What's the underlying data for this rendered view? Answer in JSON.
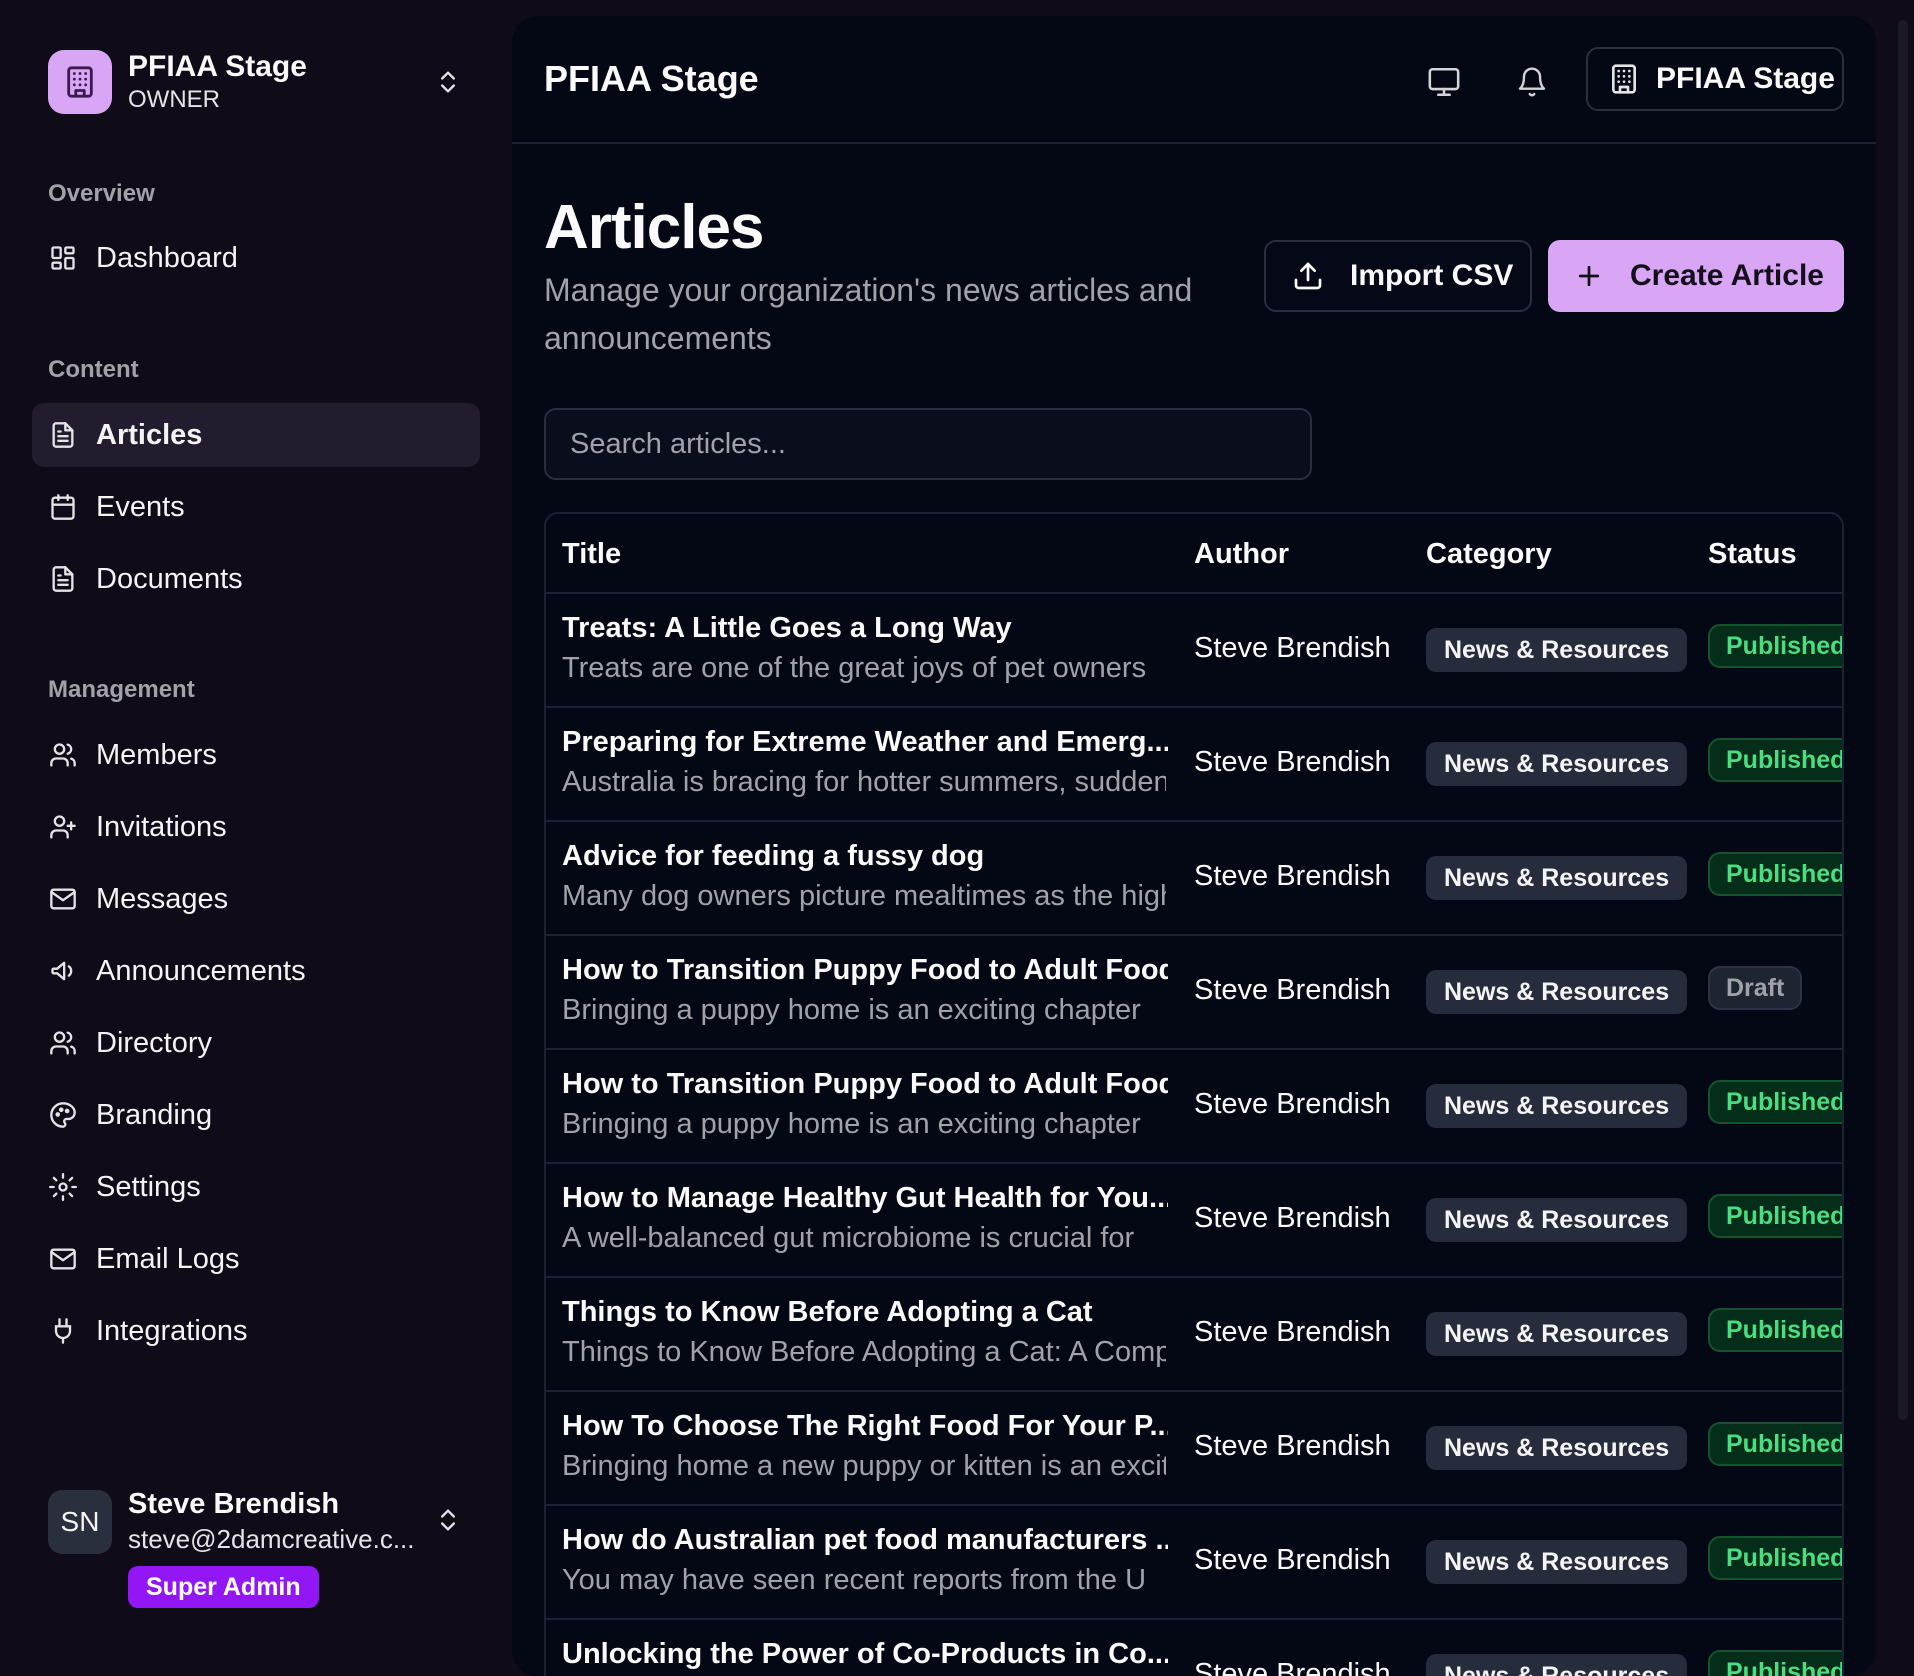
{
  "sidebar": {
    "org": {
      "name": "PFIAA Stage",
      "role": "OWNER"
    },
    "sections": [
      {
        "label": "Overview"
      },
      {
        "label": "Content"
      },
      {
        "label": "Management"
      }
    ],
    "items": [
      {
        "label": "Dashboard",
        "icon": "dashboard-icon"
      },
      {
        "label": "Articles",
        "icon": "document-icon",
        "active": true
      },
      {
        "label": "Events",
        "icon": "calendar-icon"
      },
      {
        "label": "Documents",
        "icon": "document-icon"
      },
      {
        "label": "Members",
        "icon": "users-icon"
      },
      {
        "label": "Invitations",
        "icon": "user-plus-icon"
      },
      {
        "label": "Messages",
        "icon": "mail-icon"
      },
      {
        "label": "Announcements",
        "icon": "megaphone-icon"
      },
      {
        "label": "Directory",
        "icon": "users-icon"
      },
      {
        "label": "Branding",
        "icon": "palette-icon"
      },
      {
        "label": "Settings",
        "icon": "gear-icon"
      },
      {
        "label": "Email Logs",
        "icon": "mail-icon"
      },
      {
        "label": "Integrations",
        "icon": "plug-icon"
      }
    ],
    "user": {
      "initials": "SN",
      "name": "Steve Brendish",
      "email": "steve@2damcreative.c...",
      "badge": "Super Admin"
    }
  },
  "topbar": {
    "title": "PFIAA Stage",
    "org_button": "PFIAA Stage"
  },
  "page": {
    "title": "Articles",
    "subtitle": "Manage your organization's news articles and announcements",
    "import_label": "Import CSV",
    "create_label": "Create Article",
    "search_placeholder": "Search articles..."
  },
  "table": {
    "columns": [
      "Title",
      "Author",
      "Category",
      "Status"
    ],
    "rows": [
      {
        "title": "Treats: A Little Goes a Long Way",
        "excerpt": "Treats are one of the great joys of pet owners",
        "author": "Steve Brendish",
        "category": "News & Resources",
        "status": "Published"
      },
      {
        "title": "Preparing for Extreme Weather and Emerg...",
        "excerpt": "Australia is bracing for hotter summers, sudden",
        "author": "Steve Brendish",
        "category": "News & Resources",
        "status": "Published"
      },
      {
        "title": "Advice for feeding a fussy dog",
        "excerpt": "Many dog owners picture mealtimes as the highlight",
        "author": "Steve Brendish",
        "category": "News & Resources",
        "status": "Published"
      },
      {
        "title": "How to Transition Puppy Food to Adult Food",
        "excerpt": "Bringing a puppy home is an exciting chapter",
        "author": "Steve Brendish",
        "category": "News & Resources",
        "status": "Draft"
      },
      {
        "title": "How to Transition Puppy Food to Adult Food",
        "excerpt": "Bringing a puppy home is an exciting chapter",
        "author": "Steve Brendish",
        "category": "News & Resources",
        "status": "Published"
      },
      {
        "title": "How to Manage Healthy Gut Health for You...",
        "excerpt": "A well-balanced gut microbiome is crucial for",
        "author": "Steve Brendish",
        "category": "News & Resources",
        "status": "Published"
      },
      {
        "title": "Things to Know Before Adopting a Cat",
        "excerpt": "Things to Know Before Adopting a Cat: A Complete",
        "author": "Steve Brendish",
        "category": "News & Resources",
        "status": "Published"
      },
      {
        "title": "How To Choose The Right Food For Your P...",
        "excerpt": "Bringing home a new puppy or kitten is an exciting",
        "author": "Steve Brendish",
        "category": "News & Resources",
        "status": "Published"
      },
      {
        "title": "How do Australian pet food manufacturers ...",
        "excerpt": "You may have seen recent reports from the U",
        "author": "Steve Brendish",
        "category": "News & Resources",
        "status": "Published"
      },
      {
        "title": "Unlocking the Power of Co-Products in Co...",
        "excerpt": "",
        "author": "Steve Brendish",
        "category": "News & Resources",
        "status": "Published"
      }
    ]
  },
  "colors": {
    "accent": "#d8a6f5",
    "badge_purple": "#9317f5",
    "published_green": "#4ade80",
    "sidebar_bg": "#100b18",
    "main_bg": "#040714"
  }
}
